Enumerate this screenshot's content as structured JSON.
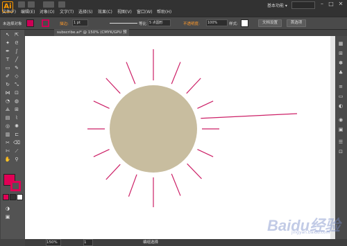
{
  "app": {
    "logo": "Ai"
  },
  "menu": [
    "文件(F)",
    "编辑(E)",
    "对象(O)",
    "文字(T)",
    "选择(S)",
    "效果(C)",
    "视图(V)",
    "窗口(W)",
    "帮助(H)"
  ],
  "window": {
    "workspace": "基本功能 ▾",
    "minimize": "–",
    "maximize": "□",
    "close": "✕"
  },
  "control_bar": {
    "selection_label": "未选择对象",
    "stroke_label": "描边:",
    "stroke_value": "1 pt",
    "stroke_profile": "等比",
    "brush_label": "5 点圆形",
    "opacity_label": "不透明度:",
    "opacity_value": "100%",
    "style_label": "样式:",
    "doc_setup": "文档设置",
    "preferences": "首选项",
    "fill_color": "#cc0055",
    "stroke_color": "#cc0055"
  },
  "document_tab": {
    "title": "subscribe.ai* @ 150% (CMYK/GPU 预览)",
    "close": "×"
  },
  "status_bar": {
    "zoom": "150%",
    "page": "1",
    "tool_name": "编组选择"
  },
  "artwork": {
    "circle_color": "#c8bd9f",
    "ray_color": "#cc1f66",
    "ray_count": 16
  },
  "watermark": {
    "text": "Baidu经验",
    "sub": "jingyan.baidu.com"
  }
}
